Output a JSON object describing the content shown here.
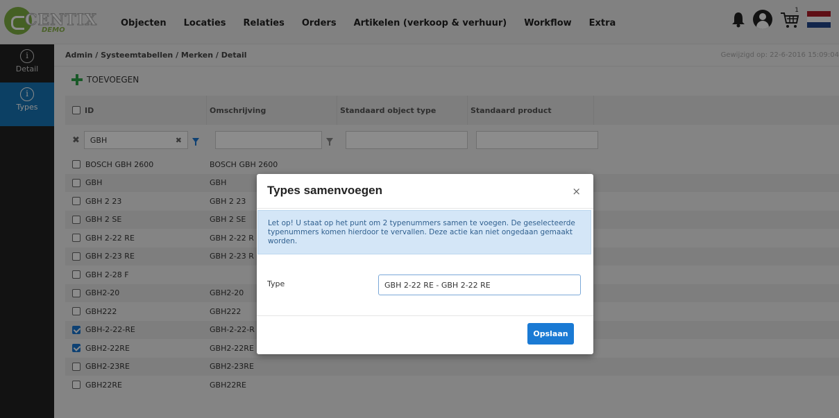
{
  "brand": {
    "name": "CENTIX",
    "tag": "DEMO"
  },
  "nav": [
    "Objecten",
    "Locaties",
    "Relaties",
    "Orders",
    "Artikelen (verkoop & verhuur)",
    "Workflow",
    "Extra"
  ],
  "top_icons": {
    "cart_count": "1"
  },
  "colors": {
    "flag_red": "#ae1c28",
    "flag_white": "#ffffff",
    "flag_blue": "#21468b",
    "accent": "#1a7ad4",
    "add_green": "#2fa34a"
  },
  "sidebar": [
    {
      "label": "Detail",
      "icon": "info-icon"
    },
    {
      "label": "Types",
      "icon": "info-icon",
      "active": true
    }
  ],
  "breadcrumb": "Admin / Systeemtabellen / Merken / Detail",
  "modified": "Gewijzigd op: 22-6-2016 15:09:04",
  "toolbar": {
    "add_label": "TOEVOEGEN"
  },
  "grid": {
    "columns": [
      "ID",
      "Omschrijving",
      "Standaard object type",
      "Standaard product"
    ],
    "filter_id": "GBH",
    "rows": [
      {
        "id": "BOSCH GBH 2600",
        "desc": "BOSCH GBH 2600",
        "checked": false
      },
      {
        "id": "GBH",
        "desc": "GBH",
        "checked": false
      },
      {
        "id": "GBH 2 23",
        "desc": "GBH 2 23",
        "checked": false
      },
      {
        "id": "GBH 2 SE",
        "desc": "GBH 2 SE",
        "checked": false
      },
      {
        "id": "GBH 2-22 RE",
        "desc": "GBH 2-22 R",
        "checked": false
      },
      {
        "id": "GBH 2-23 RE",
        "desc": "GBH 2-23 R",
        "checked": false
      },
      {
        "id": "GBH 2-28 F",
        "desc": "",
        "checked": false
      },
      {
        "id": "GBH2-20",
        "desc": "GBH2-20",
        "checked": false
      },
      {
        "id": "GBH222",
        "desc": "GBH222",
        "checked": false
      },
      {
        "id": "GBH-2-22-RE",
        "desc": "GBH-2-22-R",
        "checked": true
      },
      {
        "id": "GBH2-22RE",
        "desc": "GBH2-22RE",
        "checked": true
      },
      {
        "id": "GBH2-23RE",
        "desc": "GBH2-23RE",
        "checked": false
      },
      {
        "id": "GBH22RE",
        "desc": "GBH22RE",
        "checked": false
      }
    ]
  },
  "modal": {
    "title": "Types samenvoegen",
    "close": "×",
    "alert": "Let op! U staat op het punt om 2 typenummers samen te voegen. De geselecteerde typenummers komen hierdoor te vervallen. Deze actie kan niet ongedaan gemaakt worden.",
    "type_label": "Type",
    "type_value": "GBH 2-22 RE - GBH 2-22 RE",
    "save_label": "Opslaan"
  }
}
